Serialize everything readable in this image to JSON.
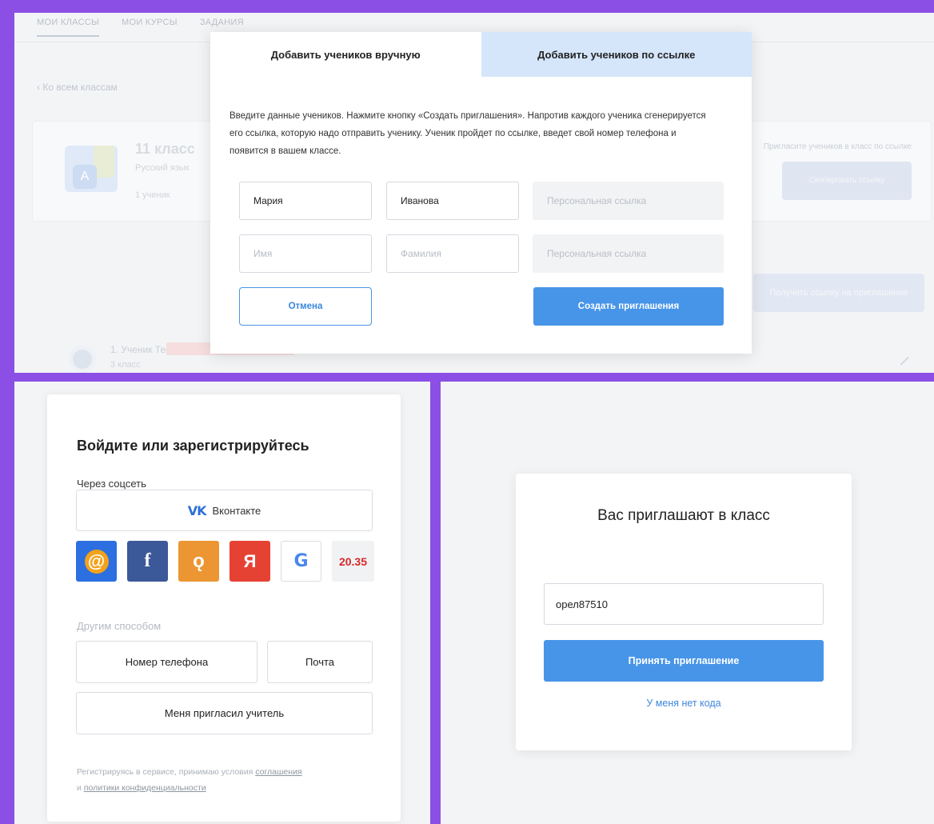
{
  "top_panel": {
    "bg_tabs": [
      "МОИ КЛАССЫ",
      "МОИ КУРСЫ",
      "ЗАДАНИЯ"
    ],
    "bg_back": "‹ Ко всем классам",
    "bg_class_name": "11 класс",
    "bg_class_subject": "Русский язык",
    "bg_class_count": "1 ученик",
    "bg_invite_hint": "Пригласите учеников в класс по ссылке",
    "bg_copy_button": "Скопировать ссылку",
    "bg_send_button": "Получить ссылку на приглашение",
    "bg_student_name": "1. Ученик Тест",
    "bg_student_sub": "3 класс",
    "modal": {
      "tab_manual": "Добавить учеников вручную",
      "tab_link": "Добавить учеников по ссылке",
      "description": "Введите данные учеников. Нажмите кнопку «Создать приглашения». Напротив каждого ученика сгенерируется его ссылка, которую надо отправить ученику. Ученик пройдет по ссылке, введет свой номер телефона и появится в вашем классе.",
      "row1": {
        "first_name": "Мария",
        "last_name": "Иванова",
        "link_placeholder": "Персональная ссылка"
      },
      "row2": {
        "first_name_placeholder": "Имя",
        "last_name_placeholder": "Фамилия",
        "link_placeholder": "Персональная ссылка"
      },
      "cancel_label": "Отмена",
      "create_label": "Создать приглашения"
    },
    "colors": {
      "primary": "#4795e8",
      "tab_inactive": "#d5e6fb",
      "frame": "#8b4fe6"
    }
  },
  "login_panel": {
    "title": "Войдите или зарегистрируйтесь",
    "social_label": "Через соцсеть",
    "vk_icon": "VK",
    "vk_label": "Вконтакте",
    "social_icons": [
      {
        "name": "mail-ru-icon",
        "glyph": "@"
      },
      {
        "name": "facebook-icon",
        "glyph": "f"
      },
      {
        "name": "odnoklassniki-icon",
        "glyph": "ǫ"
      },
      {
        "name": "yandex-icon",
        "glyph": "Я"
      },
      {
        "name": "google-icon",
        "glyph": "G"
      },
      {
        "name": "gosuslugi-icon",
        "glyph": "20.35"
      }
    ],
    "other_label": "Другим способом",
    "phone_label": "Номер телефона",
    "email_label": "Почта",
    "teacher_label": "Меня пригласил учитель",
    "terms_prefix": "Регистрируясь в сервисе, принимаю условия ",
    "terms_link1": "соглашения",
    "terms_mid": "и ",
    "terms_link2": "политики конфиденциальности"
  },
  "invite_panel": {
    "title": "Вас приглашают в класс",
    "code_value": "орел87510",
    "accept_label": "Принять приглашение",
    "no_code_label": "У меня нет кода"
  }
}
